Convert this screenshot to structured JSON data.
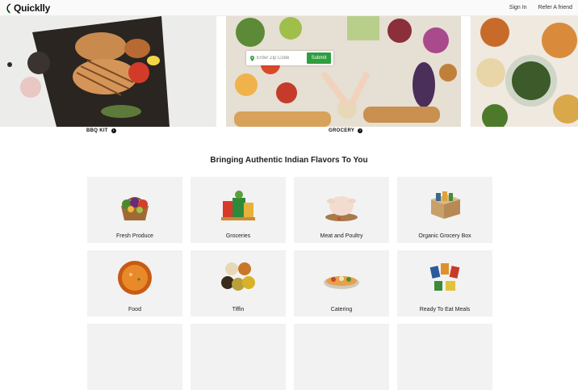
{
  "header": {
    "logo_text": "Quicklly",
    "nav": [
      {
        "label": "Sign In"
      },
      {
        "label": "Refer A friend"
      }
    ]
  },
  "hero": {
    "categories": [
      {
        "label": "BBQ KIT"
      },
      {
        "label": "GROCERY"
      }
    ],
    "zip": {
      "placeholder": "Enter Zip Code",
      "submit_label": "Submit"
    }
  },
  "section": {
    "title": "Bringing Authentic Indian Flavors To You"
  },
  "cards": [
    {
      "label": "Fresh Produce",
      "icon": "produce-basket-icon"
    },
    {
      "label": "Groceries",
      "icon": "grocery-bags-icon"
    },
    {
      "label": "Meat and Poultry",
      "icon": "roast-chicken-icon"
    },
    {
      "label": "Organic Grocery Box",
      "icon": "grocery-box-icon"
    },
    {
      "label": "Food",
      "icon": "curry-bowl-icon"
    },
    {
      "label": "Tiffin",
      "icon": "tiffin-bowls-icon"
    },
    {
      "label": "Catering",
      "icon": "catering-platter-icon"
    },
    {
      "label": "Ready To Eat Meals",
      "icon": "meal-packets-icon"
    }
  ],
  "colors": {
    "accent": "#2e9e3e",
    "card_bg": "#f2f2f2"
  }
}
